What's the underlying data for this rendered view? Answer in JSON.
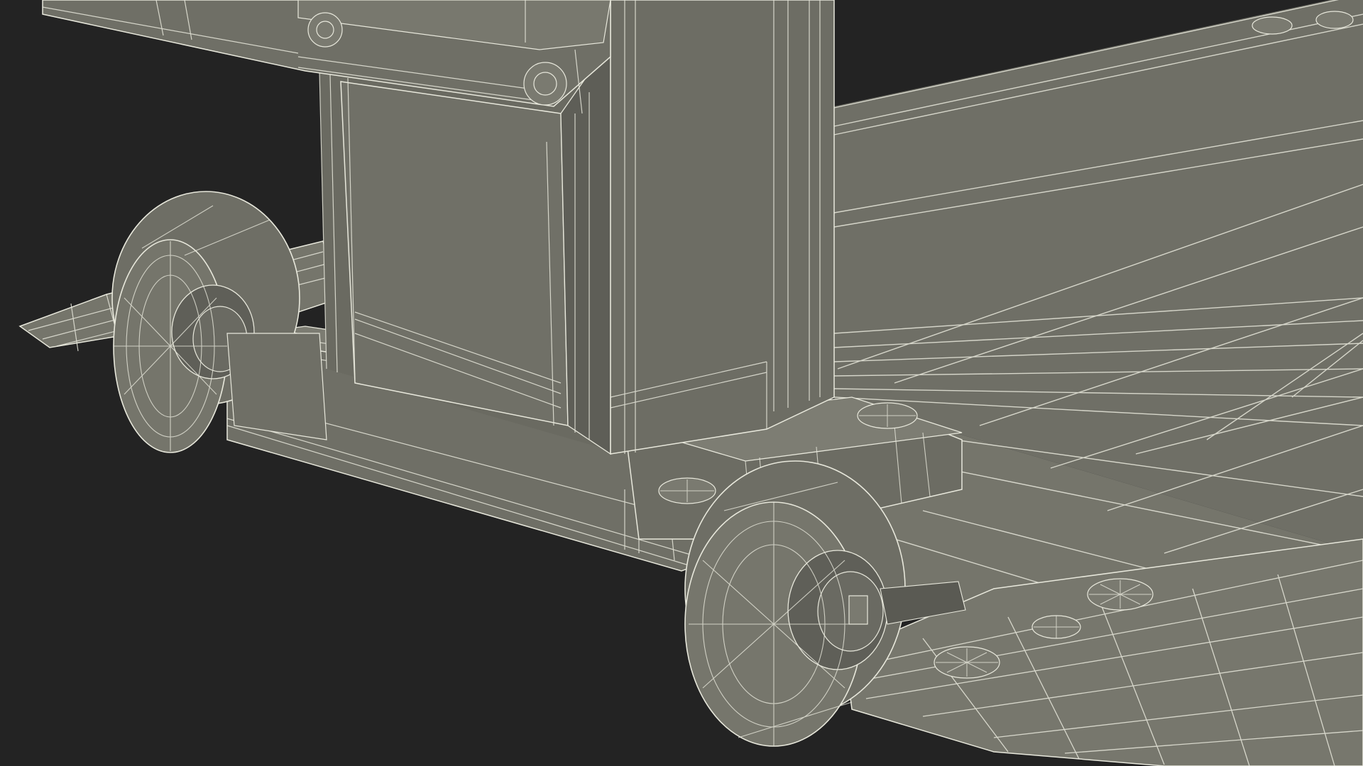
{
  "scene": {
    "subject": "wireframe-render-pallet-jack-base",
    "background_color": "#232323",
    "surface_color": "#76766c",
    "surface_dark_color": "#5c5c55",
    "wire_color": "#e6e6da"
  }
}
